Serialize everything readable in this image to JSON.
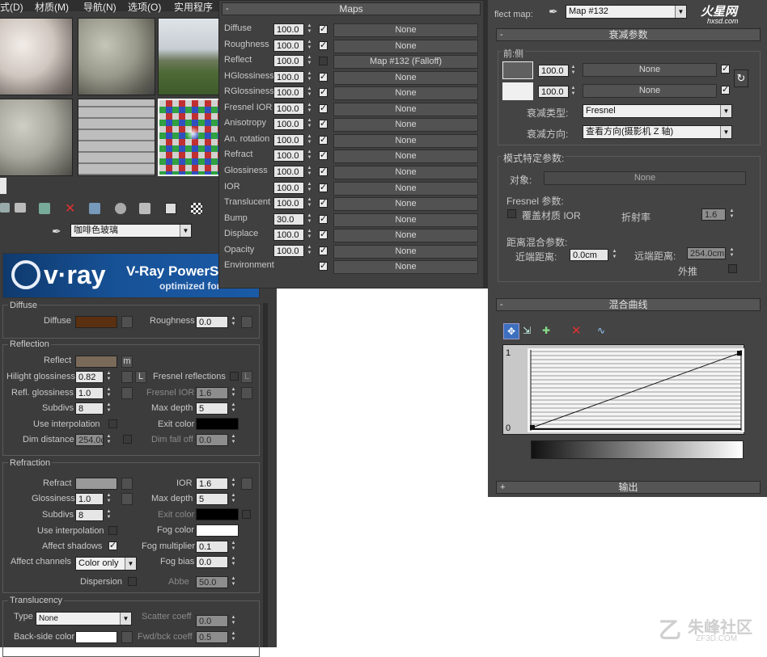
{
  "menu": [
    "式(D)",
    "材质(M)",
    "导航(N)",
    "选项(O)",
    "实用程序"
  ],
  "material_name": "咖啡色玻璃",
  "vray_banner": {
    "logo": "v·ray",
    "title": "V-Ray PowerSh",
    "subtitle": "optimized for"
  },
  "diffuse": {
    "title": "Diffuse",
    "diffuse_label": "Diffuse",
    "diffuse_color": "#5a3010",
    "roughness_label": "Roughness",
    "roughness_value": "0.0"
  },
  "reflection": {
    "title": "Reflection",
    "reflect_label": "Reflect",
    "reflect_color": "#7a6a5a",
    "m_label": "m",
    "hilight_label": "Hilight glossiness",
    "hilight_value": "0.82",
    "l_label": "L",
    "fresnel_refl_label": "Fresnel reflections",
    "refl_gloss_label": "Refl. glossiness",
    "refl_gloss_value": "1.0",
    "fresnel_ior_label": "Fresnel IOR",
    "fresnel_ior_value": "1.6",
    "subdivs_label": "Subdivs",
    "subdivs_value": "8",
    "max_depth_label": "Max depth",
    "max_depth_value": "5",
    "use_interp_label": "Use interpolation",
    "exit_color_label": "Exit color",
    "dim_dist_label": "Dim distance",
    "dim_dist_value": "254.0c",
    "dim_falloff_label": "Dim fall off",
    "dim_falloff_value": "0.0"
  },
  "refraction": {
    "title": "Refraction",
    "refract_label": "Refract",
    "refract_color": "#9a9a9a",
    "ior_label": "IOR",
    "ior_value": "1.6",
    "gloss_label": "Glossiness",
    "gloss_value": "1.0",
    "max_depth_label": "Max depth",
    "max_depth_value": "5",
    "subdivs_label": "Subdivs",
    "subdivs_value": "8",
    "exit_color_label": "Exit color",
    "use_interp_label": "Use interpolation",
    "fog_color_label": "Fog color",
    "affect_shadows_label": "Affect shadows",
    "fog_mult_label": "Fog multiplier",
    "fog_mult_value": "0.1",
    "affect_channels_label": "Affect channels",
    "affect_channels_value": "Color only",
    "fog_bias_label": "Fog bias",
    "fog_bias_value": "0.0",
    "dispersion_label": "Dispersion",
    "abbe_label": "Abbe",
    "abbe_value": "50.0"
  },
  "translucency": {
    "title": "Translucency",
    "type_label": "Type",
    "type_value": "None",
    "scatter_label": "Scatter coeff",
    "scatter_value": "0.0",
    "backside_label": "Back-side color",
    "fwd_label": "Fwd/bck coeff",
    "fwd_value": "0.5"
  },
  "maps": {
    "title": "Maps",
    "rows": [
      {
        "name": "Diffuse",
        "value": "100.0",
        "checked": true,
        "map": "None"
      },
      {
        "name": "Roughness",
        "value": "100.0",
        "checked": true,
        "map": "None"
      },
      {
        "name": "Reflect",
        "value": "100.0",
        "checked": false,
        "map": "Map #132 (Falloff)"
      },
      {
        "name": "HGlossiness",
        "value": "100.0",
        "checked": true,
        "map": "None"
      },
      {
        "name": "RGlossiness",
        "value": "100.0",
        "checked": true,
        "map": "None"
      },
      {
        "name": "Fresnel IOR",
        "value": "100.0",
        "checked": true,
        "map": "None"
      },
      {
        "name": "Anisotropy",
        "value": "100.0",
        "checked": true,
        "map": "None"
      },
      {
        "name": "An. rotation",
        "value": "100.0",
        "checked": true,
        "map": "None"
      },
      {
        "name": "Refract",
        "value": "100.0",
        "checked": true,
        "map": "None"
      },
      {
        "name": "Glossiness",
        "value": "100.0",
        "checked": true,
        "map": "None"
      },
      {
        "name": "IOR",
        "value": "100.0",
        "checked": true,
        "map": "None"
      },
      {
        "name": "Translucent",
        "value": "100.0",
        "checked": true,
        "map": "None"
      },
      {
        "name": "Bump",
        "value": "30.0",
        "checked": true,
        "map": "None"
      },
      {
        "name": "Displace",
        "value": "100.0",
        "checked": true,
        "map": "None"
      },
      {
        "name": "Opacity",
        "value": "100.0",
        "checked": true,
        "map": "None"
      },
      {
        "name": "Environment",
        "value": "",
        "checked": true,
        "map": "None"
      }
    ]
  },
  "falloff": {
    "map_label": "flect map:",
    "map_name": "Map #132",
    "logo": "火星网",
    "logo_sub": "hxsd.com",
    "params_title": "衰减参数",
    "front_side_label": "前:侧",
    "front_value": "100.0",
    "front_map": "None",
    "side_value": "100.0",
    "side_map": "None",
    "falloff_type_label": "衰减类型:",
    "falloff_type_value": "Fresnel",
    "falloff_dir_label": "衰减方向:",
    "falloff_dir_value": "查看方向(摄影机 Z 轴)",
    "mode_title": "模式特定参数:",
    "object_label": "对象:",
    "object_value": "None",
    "fresnel_params_label": "Fresnel 参数:",
    "override_ior_label": "覆盖材质 IOR",
    "ior_label": "折射率",
    "ior_value": "1.6",
    "distance_blend_label": "距离混合参数:",
    "near_label": "近端距离:",
    "near_value": "0.0cm",
    "far_label": "远端距离:",
    "far_value": "254.0cm",
    "extrapolate_label": "外推",
    "mix_curve_title": "混合曲线",
    "curve_y_top": "1",
    "curve_y_bottom": "0",
    "output_title": "输出"
  },
  "watermark": {
    "text": "朱峰社区",
    "sub": "ZF3D.COM"
  }
}
